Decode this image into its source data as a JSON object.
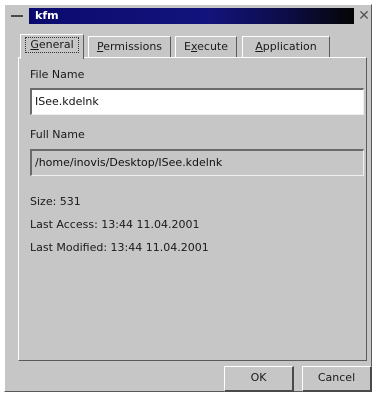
{
  "window": {
    "title": "kfm"
  },
  "tabs": [
    {
      "label": "General",
      "mnemonic_prefix": "",
      "mnemonic": "G",
      "rest": "eneral",
      "active": true
    },
    {
      "label": "Permissions",
      "mnemonic_prefix": "",
      "mnemonic": "P",
      "rest": "ermissions",
      "active": false
    },
    {
      "label": "Execute",
      "mnemonic_prefix": "E",
      "mnemonic": "x",
      "rest": "ecute",
      "active": false
    },
    {
      "label": "Application",
      "mnemonic_prefix": "",
      "mnemonic": "A",
      "rest": "pplication",
      "active": false
    }
  ],
  "general": {
    "file_name_label": "File Name",
    "file_name_value": "ISee.kdelnk",
    "full_name_label": "Full Name",
    "full_name_value": "/home/inovis/Desktop/ISee.kdelnk",
    "size_text": "Size: 531",
    "last_access_text": "Last Access: 13:44 11.04.2001",
    "last_modified_text": "Last Modified: 13:44 11.04.2001"
  },
  "buttons": {
    "ok_label": "OK",
    "cancel_label": "Cancel"
  },
  "colors": {
    "window_bg": "#c6c6c6",
    "titlebar_active": "#13137d"
  }
}
